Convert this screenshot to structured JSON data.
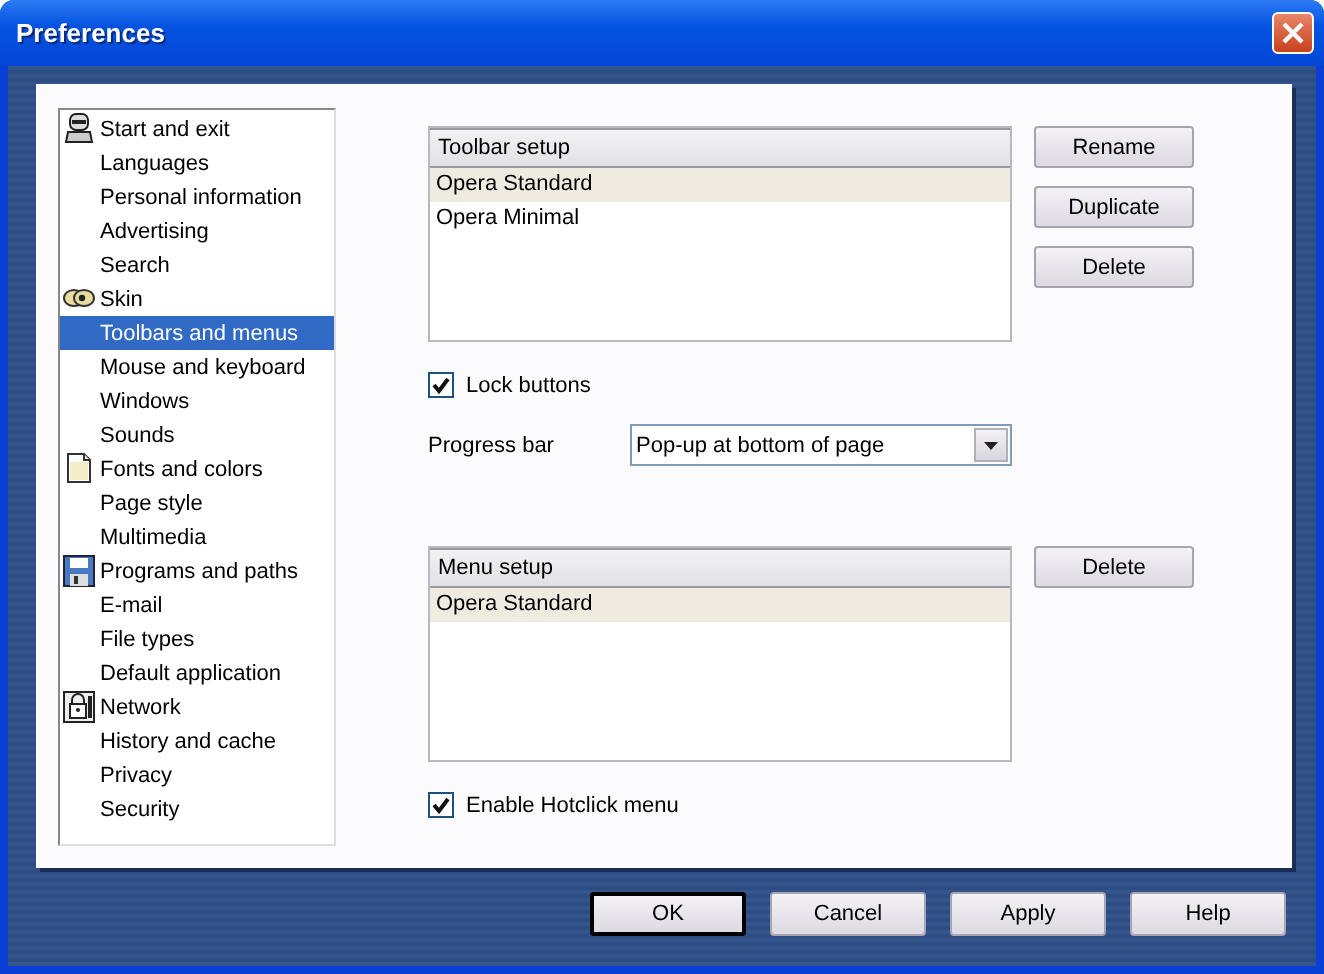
{
  "window": {
    "title": "Preferences"
  },
  "sidebar": {
    "items": [
      {
        "label": "Start and exit",
        "selected": false,
        "children": [
          {
            "label": "Languages",
            "selected": false
          },
          {
            "label": "Personal information",
            "selected": false
          },
          {
            "label": "Advertising",
            "selected": false
          },
          {
            "label": "Search",
            "selected": false
          }
        ]
      },
      {
        "label": "Skin",
        "selected": false,
        "children": [
          {
            "label": "Toolbars and menus",
            "selected": true
          },
          {
            "label": "Mouse and keyboard",
            "selected": false
          },
          {
            "label": "Windows",
            "selected": false
          },
          {
            "label": "Sounds",
            "selected": false
          }
        ]
      },
      {
        "label": "Fonts and colors",
        "selected": false,
        "children": [
          {
            "label": "Page style",
            "selected": false
          },
          {
            "label": "Multimedia",
            "selected": false
          }
        ]
      },
      {
        "label": "Programs and paths",
        "selected": false,
        "children": [
          {
            "label": "E-mail",
            "selected": false
          },
          {
            "label": "File types",
            "selected": false
          },
          {
            "label": "Default application",
            "selected": false
          }
        ]
      },
      {
        "label": "Network",
        "selected": false,
        "children": [
          {
            "label": "History and cache",
            "selected": false
          },
          {
            "label": "Privacy",
            "selected": false
          },
          {
            "label": "Security",
            "selected": false
          }
        ]
      }
    ]
  },
  "toolbar_setup": {
    "header": "Toolbar setup",
    "rows": [
      {
        "label": "Opera Standard",
        "selected": true
      },
      {
        "label": "Opera Minimal",
        "selected": false
      }
    ],
    "buttons": [
      "Rename",
      "Duplicate",
      "Delete"
    ]
  },
  "lock_buttons": {
    "label": "Lock buttons",
    "checked": true
  },
  "progress_bar": {
    "label": "Progress bar",
    "value": "Pop-up at bottom of page"
  },
  "menu_setup": {
    "header": "Menu setup",
    "rows": [
      {
        "label": "Opera Standard",
        "selected": true
      }
    ],
    "buttons": [
      "Delete"
    ]
  },
  "enable_hotclick": {
    "label": "Enable Hotclick menu",
    "checked": true
  },
  "buttons": [
    {
      "label": "OK",
      "default": true
    },
    {
      "label": "Cancel",
      "default": false
    },
    {
      "label": "Apply",
      "default": false
    },
    {
      "label": "Help",
      "default": false
    }
  ]
}
